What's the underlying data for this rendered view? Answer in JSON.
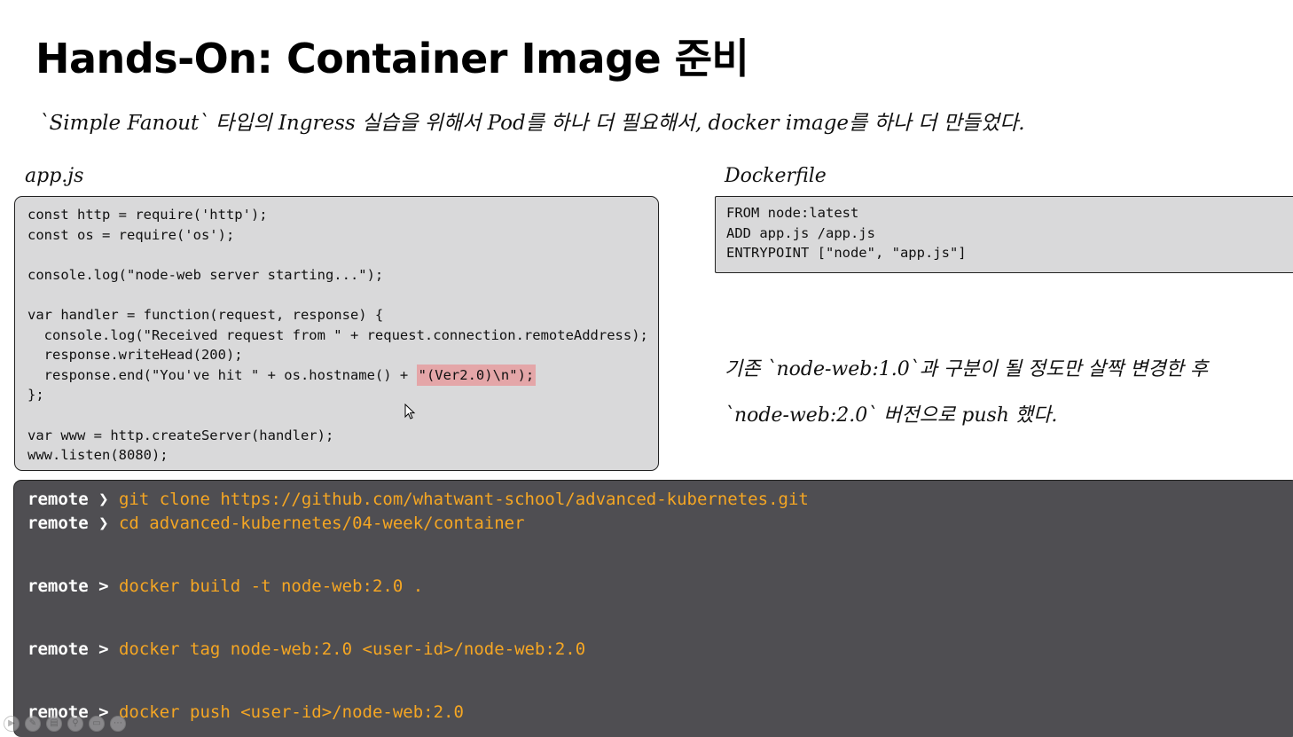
{
  "slide": {
    "title": "Hands-On: Container Image 준비",
    "subtitle": "`Simple Fanout` 타입의 Ingress 실습을 위해서 Pod를 하나 더 필요해서, docker image를 하나 더 만들었다.",
    "app_label": "app.js",
    "docker_label": "Dockerfile",
    "note_line1": "기존 `node-web:1.0`과 구분이 될 정도만 살짝 변경한 후",
    "note_line2": "`node-web:2.0` 버전으로 push 했다."
  },
  "app_js": {
    "lines": [
      "const http = require('http');",
      "const os = require('os');",
      "",
      "console.log(\"node-web server starting...\");",
      "",
      "var handler = function(request, response) {",
      "  console.log(\"Received request from \" + request.connection.remoteAddress);",
      "  response.writeHead(200);",
      "  response.end(\"You've hit \" + os.hostname() + ",
      "};",
      "",
      "var www = http.createServer(handler);",
      "www.listen(8080);"
    ],
    "highlight": "\"(Ver2.0)\\n\");"
  },
  "dockerfile": {
    "lines": [
      "FROM node:latest",
      "ADD app.js /app.js",
      "ENTRYPOINT [\"node\", \"app.js\"]"
    ]
  },
  "terminal": {
    "prompt": "remote ❯",
    "prompt_gt": "remote >",
    "commands": [
      "git clone https://github.com/whatwant-school/advanced-kubernetes.git",
      "cd advanced-kubernetes/04-week/container",
      "docker build -t node-web:2.0 .",
      "docker tag node-web:2.0 <user-id>/node-web:2.0",
      "docker push <user-id>/node-web:2.0"
    ]
  },
  "colors": {
    "terminal_bg": "#4f4e52",
    "command_text": "#f5a623",
    "code_bg": "#d9d9da",
    "highlight_bg": "#e4a6a8"
  },
  "player": {
    "icons": [
      "play-icon",
      "pen-icon",
      "slides-icon",
      "zoom-icon",
      "subtitle-icon",
      "more-icon"
    ],
    "labels": [
      "▶",
      "✎",
      "▤",
      "⚲",
      "▭",
      "⋯"
    ]
  }
}
